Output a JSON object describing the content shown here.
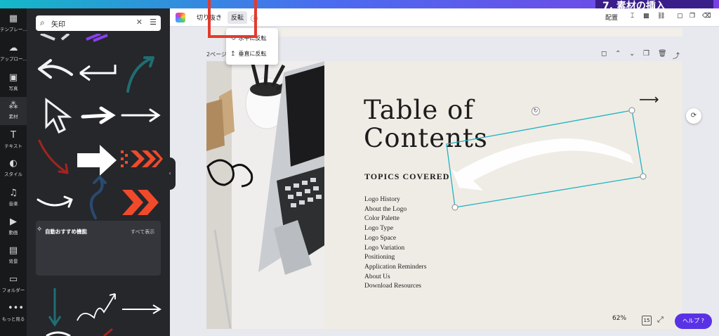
{
  "banner": {
    "text": "7. 素材の挿入"
  },
  "rail": {
    "items": [
      {
        "label": "テンプレー…",
        "icon": "template-icon"
      },
      {
        "label": "アップロー…",
        "icon": "upload-icon"
      },
      {
        "label": "写真",
        "icon": "photo-icon"
      },
      {
        "label": "素材",
        "icon": "elements-icon"
      },
      {
        "label": "テキスト",
        "icon": "text-icon"
      },
      {
        "label": "スタイル",
        "icon": "style-icon"
      },
      {
        "label": "音楽",
        "icon": "music-icon"
      },
      {
        "label": "動画",
        "icon": "video-icon"
      },
      {
        "label": "背景",
        "icon": "background-icon"
      },
      {
        "label": "フォルダー",
        "icon": "folder-icon"
      },
      {
        "label": "もっと見る",
        "icon": "more-icon"
      }
    ]
  },
  "search": {
    "value": "矢印"
  },
  "recommend": {
    "title": "自動おすすめ機能",
    "see_all": "すべて表示"
  },
  "toolbar": {
    "crop": "切り抜き",
    "flip": "反転",
    "position": "配置"
  },
  "flip_menu": {
    "horizontal": "水平に反転",
    "vertical": "垂直に反転"
  },
  "page": {
    "label": "2ページ",
    "title_line1": "Table of",
    "title_line2": "Contents",
    "topics_heading": "TOPICS COVERED",
    "toc": [
      "Logo History",
      "About the Logo",
      "Color Palette",
      "Logo Type",
      "Logo Space",
      "Logo Variation",
      "Positioning",
      "Application Reminders",
      "About Us",
      "Download Resources"
    ]
  },
  "footer": {
    "zoom": "62%",
    "pages": "15",
    "help": "ヘルプ ?"
  },
  "colors": {
    "accent": "#5a32e6",
    "highlight": "#e23b2e",
    "selection": "#1fb3c4"
  }
}
